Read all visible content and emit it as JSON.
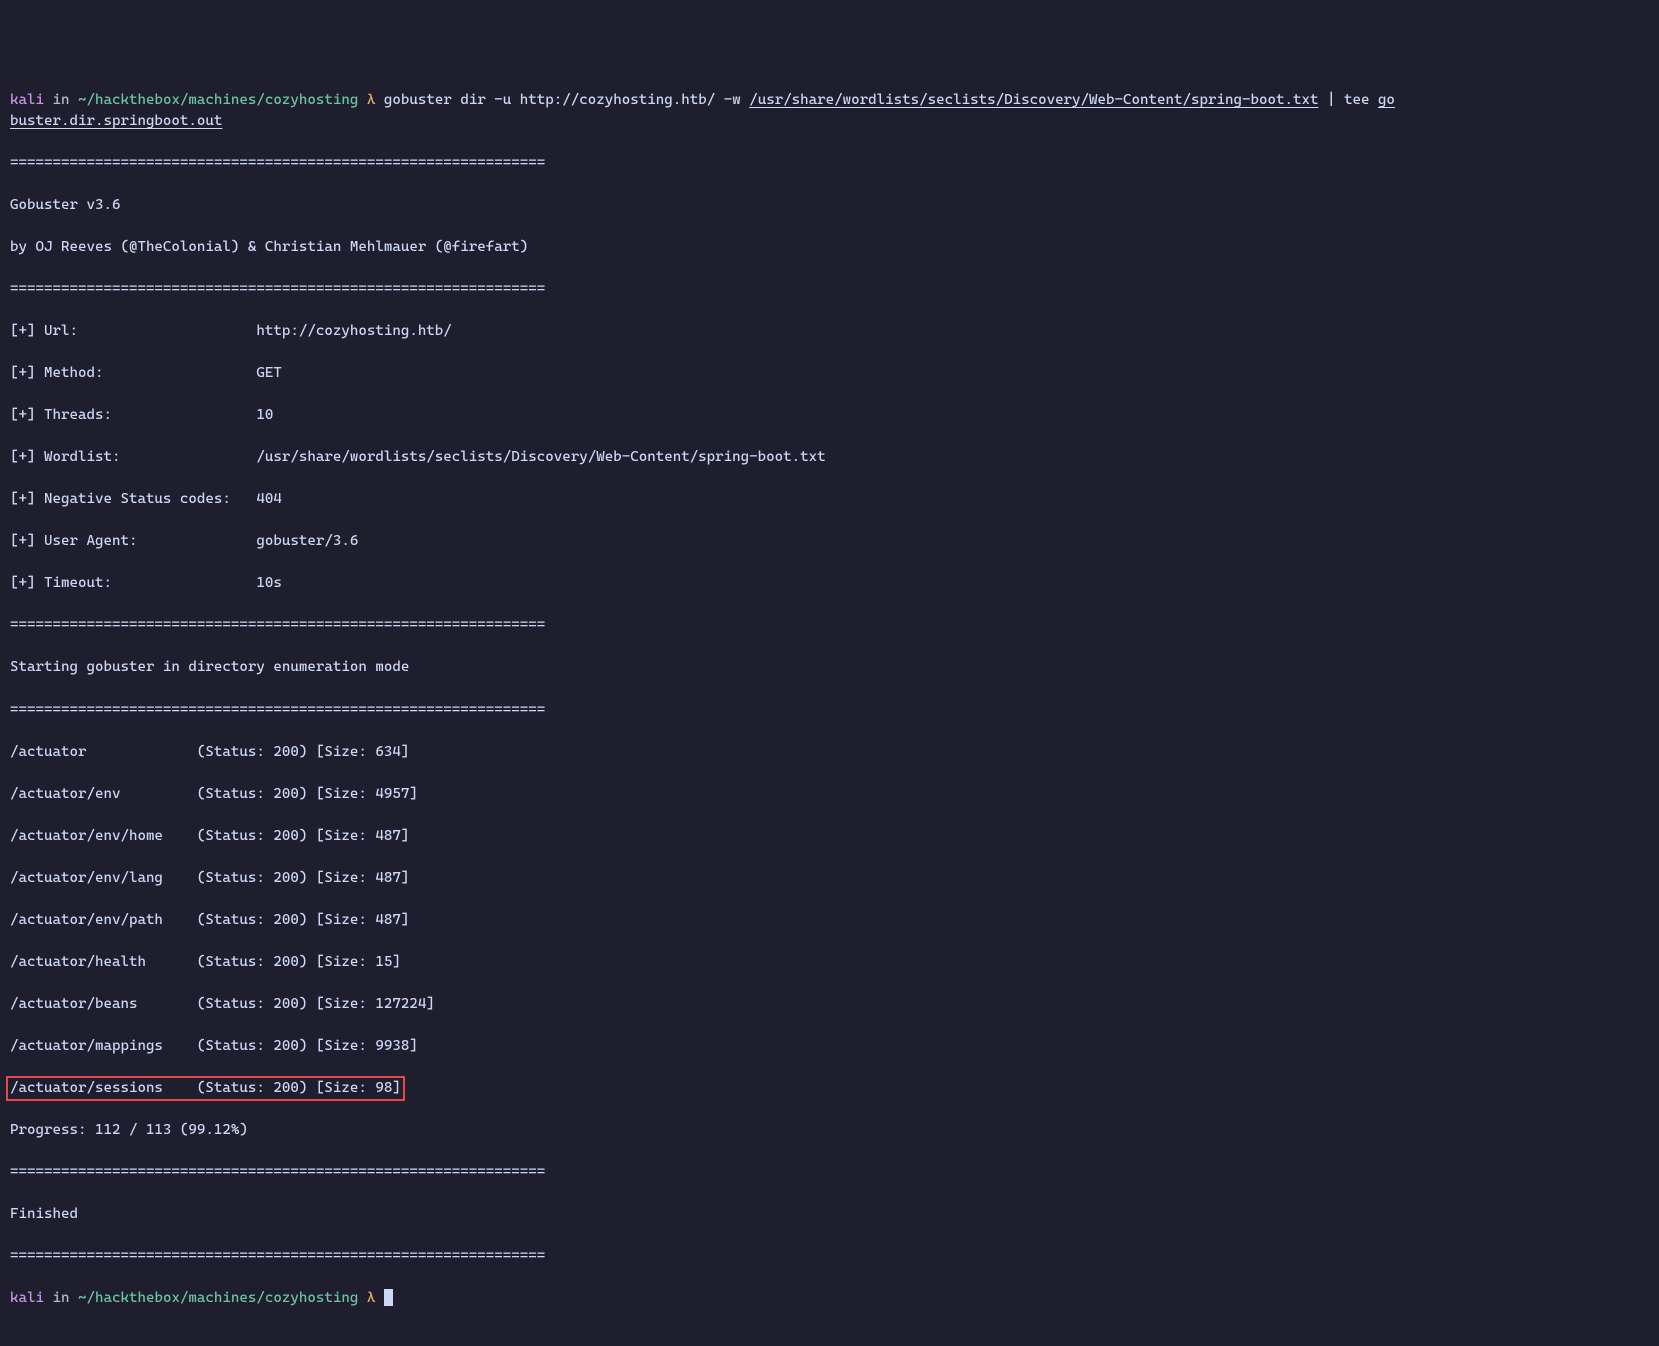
{
  "prompt1": {
    "user": "kali",
    "in": "in",
    "path": "~/hackthebox/machines/cozyhosting",
    "lambda": "λ",
    "cmd_part1": "gobuster dir -u http://cozyhosting.htb/ -w ",
    "wordlist": "/usr/share/wordlists/seclists/Discovery/Web-Content/spring-boot.txt",
    "pipe": " | ",
    "tee": "tee ",
    "outfile1": "go",
    "outfile2": "buster.dir.springboot.out"
  },
  "rule": "===============================================================",
  "banner": {
    "l1": "Gobuster v3.6",
    "l2": "by OJ Reeves (@TheColonial) & Christian Mehlmauer (@firefart)"
  },
  "info": {
    "url": "[+] Url:                     http://cozyhosting.htb/",
    "method": "[+] Method:                  GET",
    "threads": "[+] Threads:                 10",
    "wordlist": "[+] Wordlist:                /usr/share/wordlists/seclists/Discovery/Web-Content/spring-boot.txt",
    "neg": "[+] Negative Status codes:   404",
    "ua": "[+] User Agent:              gobuster/3.6",
    "timeout": "[+] Timeout:                 10s"
  },
  "starting": "Starting gobuster in directory enumeration mode",
  "results": [
    "/actuator             (Status: 200) [Size: 634]",
    "/actuator/env         (Status: 200) [Size: 4957]",
    "/actuator/env/home    (Status: 200) [Size: 487]",
    "/actuator/env/lang    (Status: 200) [Size: 487]",
    "/actuator/env/path    (Status: 200) [Size: 487]",
    "/actuator/health      (Status: 200) [Size: 15]",
    "/actuator/beans       (Status: 200) [Size: 127224]",
    "/actuator/mappings    (Status: 200) [Size: 9938]"
  ],
  "highlighted": "/actuator/sessions    (Status: 200) [Size: 98]",
  "progress": "Progress: 112 / 113 (99.12%)",
  "finished": "Finished",
  "prompt2": {
    "user": "kali",
    "in": "in",
    "path": "~/hackthebox/machines/cozyhosting",
    "lambda": "λ"
  }
}
